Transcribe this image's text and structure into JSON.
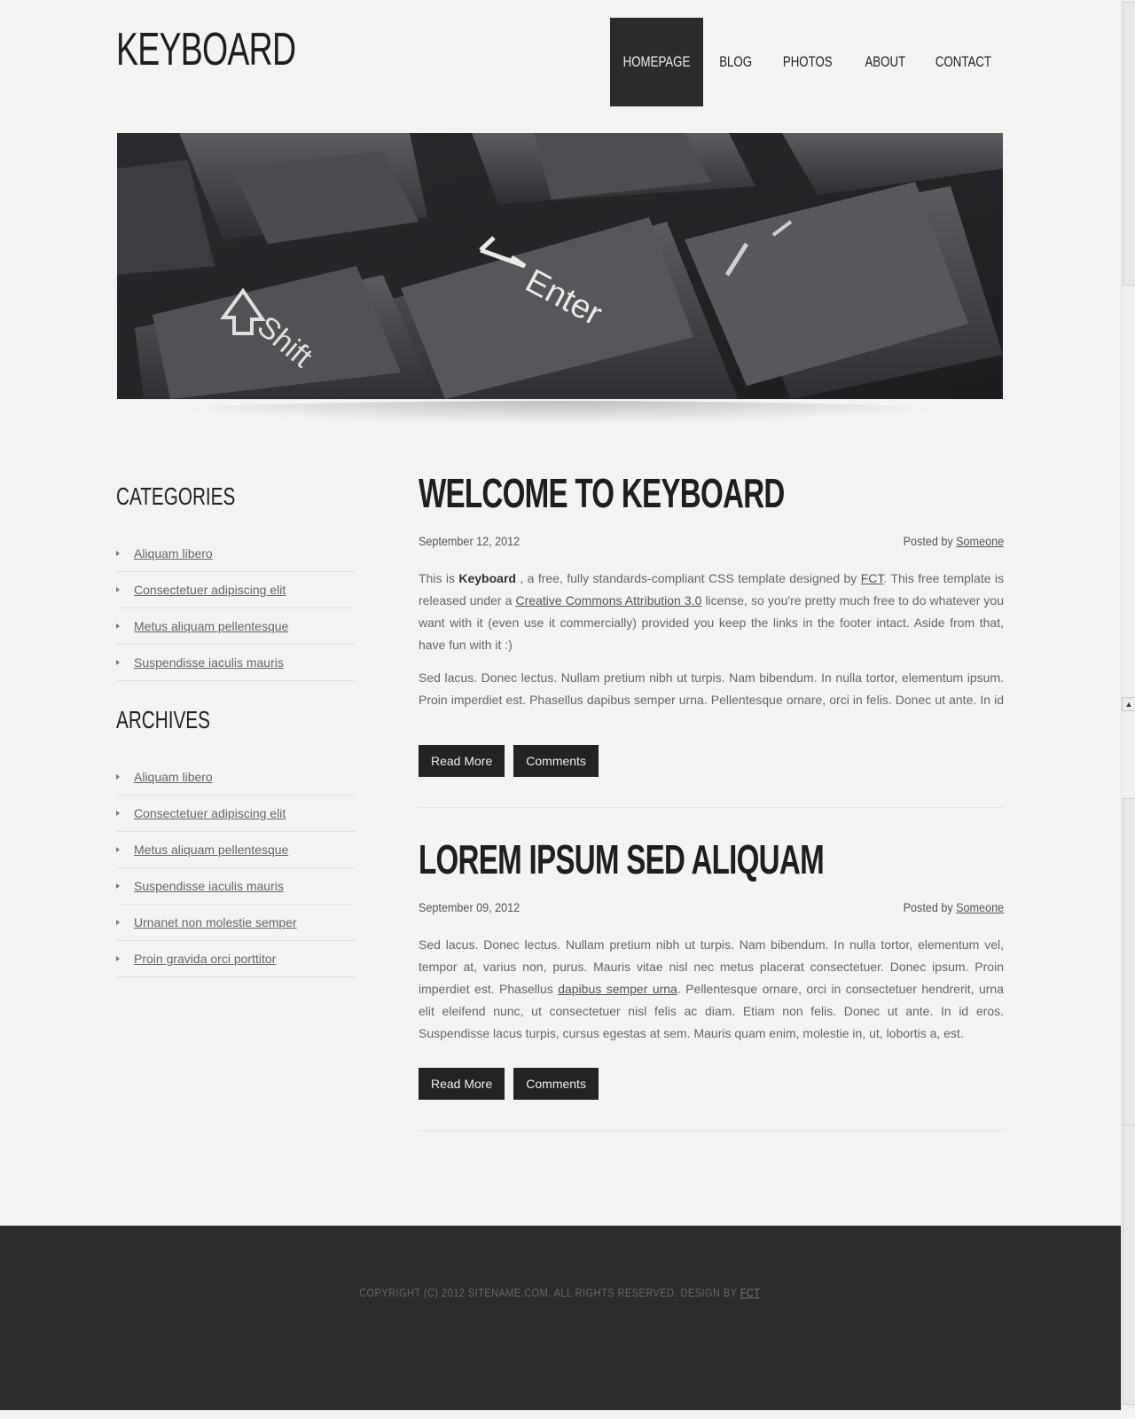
{
  "site": {
    "logo": "KEYBOARD"
  },
  "nav": {
    "items": [
      {
        "label": "HOMEPAGE",
        "active": true
      },
      {
        "label": "BLOG",
        "active": false
      },
      {
        "label": "PHOTOS",
        "active": false
      },
      {
        "label": "ABOUT",
        "active": false
      },
      {
        "label": "CONTACT",
        "active": false
      }
    ],
    "active_bg": "#2b2b2b"
  },
  "banner": {
    "keys": [
      "Enter",
      "Shift"
    ],
    "icons": [
      "enter-arrow-icon",
      "shift-arrow-icon"
    ]
  },
  "sidebar": {
    "categories": {
      "title": "CATEGORIES",
      "items": [
        "Aliquam libero",
        "Consectetuer adipiscing elit",
        "Metus aliquam pellentesque",
        "Suspendisse iaculis mauris"
      ]
    },
    "archives": {
      "title": "ARCHIVES",
      "items": [
        "Aliquam libero",
        "Consectetuer adipiscing elit",
        "Metus aliquam pellentesque",
        "Suspendisse iaculis mauris",
        "Urnanet non molestie semper",
        "Proin gravida orci porttitor"
      ]
    }
  },
  "posts": [
    {
      "title": "WELCOME TO KEYBOARD",
      "date": "September 12, 2012",
      "posted_by_label": "Posted by",
      "author": "Someone",
      "p1": {
        "t1": "This is ",
        "b1": "Keyboard",
        "t2": " , a free, fully standards-compliant CSS template designed by ",
        "link1": "FCT",
        "t3": ". This free template is released under a ",
        "link2": "Creative Commons Attribution 3.0",
        "t4": " license, so you're pretty much free to do whatever you want with it (even use it commercially) provided you keep the links in the footer intact. Aside from that, have fun with it :)"
      },
      "p2": "Sed lacus. Donec lectus. Nullam pretium nibh ut turpis. Nam bibendum. In nulla tortor, elementum ipsum. Proin imperdiet est. Phasellus dapibus semper urna. Pellentesque ornare, orci in felis. Donec ut ante. In id eros.",
      "read_more": "Read More",
      "comments": "Comments"
    },
    {
      "title": "LOREM IPSUM SED ALIQUAM",
      "date": "September 09, 2012",
      "posted_by_label": "Posted by",
      "author": "Someone",
      "p1": {
        "t1": "Sed lacus. Donec lectus. Nullam pretium nibh ut turpis. Nam bibendum. In nulla tortor, elementum vel, tempor at, varius non, purus. Mauris vitae nisl nec metus placerat consectetuer. Donec ipsum. Proin imperdiet est. Phasellus ",
        "link1": "dapibus semper urna",
        "t2": ". Pellentesque ornare, orci in consectetuer hendrerit, urna elit eleifend nunc, ut consectetuer nisl felis ac diam. Etiam non felis. Donec ut ante. In id eros. Suspendisse lacus turpis, cursus egestas at sem. Mauris quam enim, molestie in, ut, lobortis a, est."
      },
      "read_more": "Read More",
      "comments": "Comments"
    }
  ],
  "footer": {
    "text": "COPYRIGHT (C) 2012 SITENAME.COM. ALL RIGHTS RESERVED. DESIGN BY ",
    "link": "FCT",
    "end": "."
  }
}
